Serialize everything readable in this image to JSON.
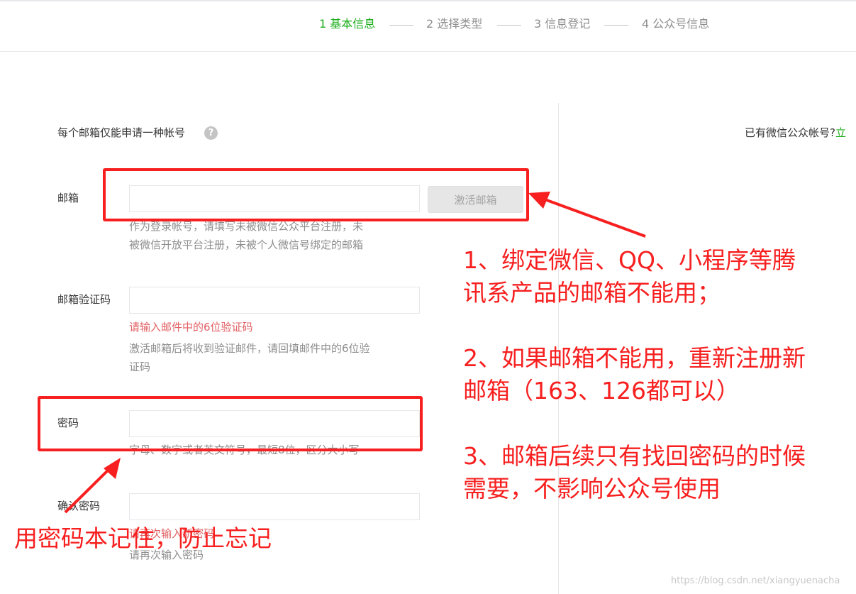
{
  "steps": [
    {
      "label": "1 基本信息"
    },
    {
      "label": "2 选择类型"
    },
    {
      "label": "3 信息登记"
    },
    {
      "label": "4 公众号信息"
    }
  ],
  "notice": {
    "text": "每个邮箱仅能申请一种帐号",
    "help_icon": "question-circle-icon",
    "help_glyph": "?"
  },
  "side": {
    "has_account_text": "已有微信公众帐号?",
    "login_link": "立"
  },
  "form": {
    "email": {
      "label": "邮箱",
      "value": "",
      "activate_button": "激活邮箱",
      "tip_line1": "作为登录帐号，请填写未被微信公众平台注册，未",
      "tip_line2": "被微信开放平台注册，未被个人微信号绑定的邮箱"
    },
    "email_code": {
      "label": "邮箱验证码",
      "value": "",
      "error": "请输入邮件中的6位验证码",
      "tip_line1": "激活邮箱后将收到验证邮件，请回填邮件中的6位验",
      "tip_line2": "证码"
    },
    "password": {
      "label": "密码",
      "value": "",
      "tip": "字母、数字或者英文符号，最短8位，区分大小写"
    },
    "confirm_password": {
      "label": "确认密码",
      "value": "",
      "error": "请再次输入新密码",
      "tip": "请再次输入密码"
    }
  },
  "annotations": {
    "right": [
      {
        "lines": [
          "1、绑定微信、QQ、小程序等腾",
          "讯系产品的邮箱不能用；"
        ]
      },
      {
        "lines": [
          "2、如果邮箱不能用，重新注册新",
          "邮箱（163、126都可以）"
        ]
      },
      {
        "lines": [
          "3、邮箱后续只有找回密码的时候",
          "需要，不影响公众号使用"
        ]
      }
    ],
    "bottom": "用密码本记住，防止忘记"
  },
  "colors": {
    "active_step": "#1aad19",
    "annotation_red": "#f71f1f",
    "error_text": "#e15f63"
  },
  "watermark": "https://blog.csdn.net/xiangyuenacha"
}
